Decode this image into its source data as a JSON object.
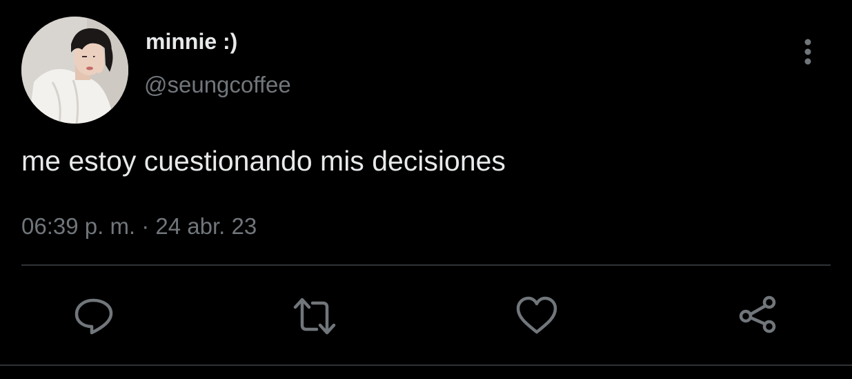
{
  "tweet": {
    "display_name": "minnie :)",
    "handle": "@seungcoffee",
    "text": "me estoy cuestionando mis decisiones",
    "timestamp": "06:39 p. m. · 24 abr. 23"
  },
  "icons": {
    "more": "more-vertical-icon",
    "reply": "reply-icon",
    "retweet": "retweet-icon",
    "like": "heart-icon",
    "share": "share-icon"
  },
  "colors": {
    "background": "#000000",
    "primary_text": "#e7e9ea",
    "secondary_text": "#71767b",
    "divider": "#2f3336"
  }
}
